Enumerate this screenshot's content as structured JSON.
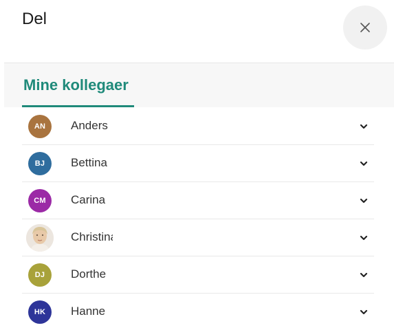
{
  "dialog": {
    "title": "Del"
  },
  "tabs": [
    {
      "label": "Mine kollegaer"
    }
  ],
  "colleagues": [
    {
      "initials": "AN",
      "name": "Anders",
      "avatar_color": "#a9743f",
      "photo": false
    },
    {
      "initials": "BJ",
      "name": "Bettina",
      "avatar_color": "#2f6d9e",
      "photo": false
    },
    {
      "initials": "CM",
      "name": "Carina",
      "avatar_color": "#9b2aa6",
      "photo": false
    },
    {
      "initials": "",
      "name": "Christina",
      "avatar_color": "#e9e2da",
      "photo": true
    },
    {
      "initials": "DJ",
      "name": "Dorthe",
      "avatar_color": "#a8a23a",
      "photo": false
    },
    {
      "initials": "HK",
      "name": "Hanne",
      "avatar_color": "#2e3599",
      "photo": false
    }
  ],
  "colors": {
    "accent": "#1f8a7a",
    "close_bg": "#f1f1f1",
    "tab_bar_bg": "#f7f7f7"
  }
}
